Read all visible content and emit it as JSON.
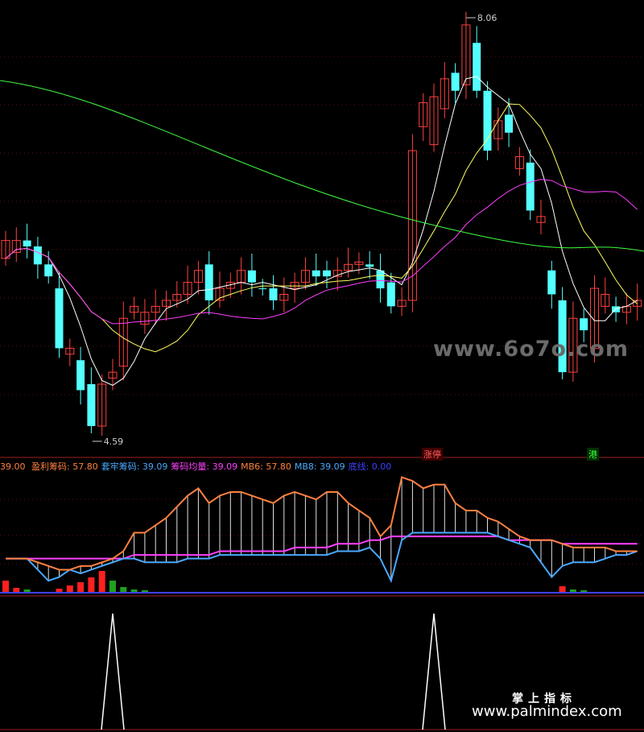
{
  "price_labels": {
    "high": "8.06",
    "low": "4.59"
  },
  "tags": {
    "zhangting": "涨停",
    "gang": "港"
  },
  "legend": {
    "left_value": "39.00",
    "items": [
      {
        "name": "盈利筹码",
        "value": "57.80",
        "color": "#ff8040"
      },
      {
        "name": "套牢筹码",
        "value": "39.09",
        "color": "#4aa8ff"
      },
      {
        "name": "筹码均量",
        "value": "39.09",
        "color": "#ff40ff"
      },
      {
        "name": "MB6",
        "value": "57.80",
        "color": "#ff8040"
      },
      {
        "name": "MB8",
        "value": "39.09",
        "color": "#4aa8ff"
      },
      {
        "name": "底线",
        "value": "0.00",
        "color": "#4040ff"
      }
    ]
  },
  "watermarks": {
    "main": "www.6o7o.com",
    "cn": "掌上指标",
    "site": "www.palmindex.com"
  },
  "chart_data": [
    {
      "type": "candlestick",
      "title": "",
      "annotations": [
        "8.06",
        "4.59"
      ],
      "ylim": [
        4.59,
        8.06
      ],
      "candles": [
        {
          "o": 6.2,
          "c": 6.05,
          "up": true
        },
        {
          "o": 6.1,
          "c": 6.2,
          "up": true
        },
        {
          "o": 6.2,
          "c": 6.15,
          "up": false
        },
        {
          "o": 6.15,
          "c": 6.0,
          "up": false
        },
        {
          "o": 6.0,
          "c": 5.9,
          "up": false
        },
        {
          "o": 5.8,
          "c": 5.3,
          "up": false
        },
        {
          "o": 5.3,
          "c": 5.25,
          "up": true
        },
        {
          "o": 5.2,
          "c": 4.95,
          "up": false
        },
        {
          "o": 5.0,
          "c": 4.65,
          "up": false
        },
        {
          "o": 4.65,
          "c": 5.0,
          "up": true
        },
        {
          "o": 5.05,
          "c": 5.1,
          "up": true
        },
        {
          "o": 5.15,
          "c": 5.55,
          "up": true
        },
        {
          "o": 5.6,
          "c": 5.65,
          "up": true
        },
        {
          "o": 5.5,
          "c": 5.6,
          "up": true
        },
        {
          "o": 5.6,
          "c": 5.65,
          "up": true
        },
        {
          "o": 5.65,
          "c": 5.7,
          "up": true
        },
        {
          "o": 5.7,
          "c": 5.75,
          "up": true
        },
        {
          "o": 5.75,
          "c": 5.85,
          "up": true
        },
        {
          "o": 5.85,
          "c": 5.95,
          "up": true
        },
        {
          "o": 6.0,
          "c": 5.7,
          "up": false
        },
        {
          "o": 5.7,
          "c": 5.8,
          "up": true
        },
        {
          "o": 5.8,
          "c": 5.85,
          "up": true
        },
        {
          "o": 5.85,
          "c": 5.95,
          "up": true
        },
        {
          "o": 5.95,
          "c": 5.85,
          "up": false
        },
        {
          "o": 5.8,
          "c": 5.8,
          "up": false
        },
        {
          "o": 5.8,
          "c": 5.7,
          "up": false
        },
        {
          "o": 5.7,
          "c": 5.75,
          "up": true
        },
        {
          "o": 5.8,
          "c": 5.85,
          "up": true
        },
        {
          "o": 5.85,
          "c": 5.95,
          "up": true
        },
        {
          "o": 5.95,
          "c": 5.9,
          "up": false
        },
        {
          "o": 5.95,
          "c": 5.9,
          "up": false
        },
        {
          "o": 5.9,
          "c": 5.95,
          "up": true
        },
        {
          "o": 5.95,
          "c": 6.0,
          "up": true
        },
        {
          "o": 6.0,
          "c": 6.02,
          "up": true
        },
        {
          "o": 6.0,
          "c": 5.98,
          "up": false
        },
        {
          "o": 5.95,
          "c": 5.8,
          "up": false
        },
        {
          "o": 5.85,
          "c": 5.65,
          "up": false
        },
        {
          "o": 5.65,
          "c": 5.7,
          "up": true
        },
        {
          "o": 5.7,
          "c": 6.95,
          "up": true
        },
        {
          "o": 7.15,
          "c": 7.35,
          "up": true
        },
        {
          "o": 7.0,
          "c": 7.4,
          "up": true
        },
        {
          "o": 7.3,
          "c": 7.55,
          "up": true
        },
        {
          "o": 7.6,
          "c": 7.45,
          "up": false
        },
        {
          "o": 7.5,
          "c": 8.0,
          "up": true
        },
        {
          "o": 7.85,
          "c": 7.45,
          "up": false
        },
        {
          "o": 7.45,
          "c": 6.95,
          "up": false
        },
        {
          "o": 7.05,
          "c": 7.2,
          "up": true
        },
        {
          "o": 7.25,
          "c": 7.1,
          "up": false
        },
        {
          "o": 6.8,
          "c": 6.9,
          "up": true
        },
        {
          "o": 6.85,
          "c": 6.45,
          "up": false
        },
        {
          "o": 6.4,
          "c": 6.35,
          "up": true
        },
        {
          "o": 5.95,
          "c": 5.75,
          "up": false
        },
        {
          "o": 5.7,
          "c": 5.1,
          "up": false
        },
        {
          "o": 5.1,
          "c": 5.55,
          "up": true
        },
        {
          "o": 5.55,
          "c": 5.45,
          "up": false
        },
        {
          "o": 5.3,
          "c": 5.8,
          "up": true
        },
        {
          "o": 5.65,
          "c": 5.75,
          "up": true
        },
        {
          "o": 5.65,
          "c": 5.6,
          "up": false
        },
        {
          "o": 5.6,
          "c": 5.65,
          "up": true
        },
        {
          "o": 5.65,
          "c": 5.7,
          "up": true
        }
      ]
    },
    {
      "type": "line",
      "title": "盈利筹码 / 套牢筹码 / 筹码均量",
      "series": [
        {
          "name": "盈利筹码",
          "values": [
            39,
            39,
            39,
            38,
            37,
            36,
            36,
            37,
            37,
            38,
            39,
            41,
            46,
            46,
            48,
            50,
            53,
            56,
            58,
            54,
            56,
            57,
            57,
            56,
            55,
            54,
            56,
            57,
            56,
            55,
            57,
            57,
            54,
            52,
            50,
            45,
            48,
            61,
            60,
            58,
            59,
            59,
            54,
            52,
            52,
            50,
            49,
            47,
            45,
            44,
            44,
            44,
            43,
            42,
            42,
            42,
            42,
            41,
            41,
            41
          ]
        },
        {
          "name": "套牢筹码",
          "values": [
            39,
            39,
            39,
            36,
            33,
            34,
            36,
            35,
            36,
            37,
            38,
            39,
            39,
            38,
            38,
            38,
            38,
            39,
            39,
            39,
            40,
            40,
            40,
            40,
            40,
            40,
            40,
            40,
            40,
            40,
            40,
            41,
            41,
            41,
            42,
            39,
            33,
            44,
            46,
            46,
            46,
            46,
            46,
            46,
            46,
            46,
            45,
            44,
            43,
            42,
            38,
            34,
            37,
            38,
            38,
            38,
            39,
            40,
            40,
            41
          ]
        },
        {
          "name": "筹码均量",
          "values": [
            39,
            39,
            39,
            39,
            39,
            39,
            39,
            39,
            39,
            39,
            39,
            39,
            40,
            40,
            40,
            40,
            40,
            40,
            40,
            40,
            41,
            41,
            41,
            41,
            41,
            41,
            41,
            42,
            42,
            42,
            42,
            43,
            43,
            43,
            44,
            44,
            45,
            45,
            45,
            45,
            45,
            45,
            45,
            45,
            45,
            45,
            45,
            44,
            44,
            44,
            44,
            44,
            43,
            43,
            43,
            43,
            43,
            43,
            43,
            43
          ]
        }
      ]
    }
  ]
}
